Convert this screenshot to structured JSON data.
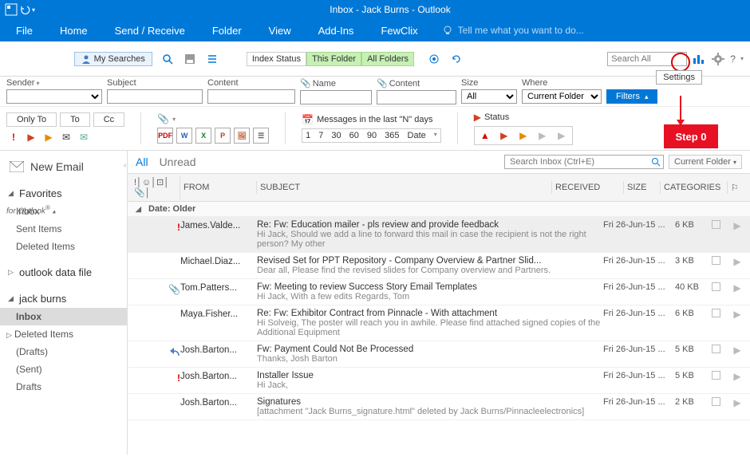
{
  "window": {
    "title": "Inbox - Jack Burns - Outlook"
  },
  "ribbon": {
    "tabs": [
      "File",
      "Home",
      "Send / Receive",
      "Folder",
      "View",
      "Add-Ins",
      "FewClix"
    ],
    "tell_me": "Tell me what you want to do..."
  },
  "fewclix": {
    "logo_main": "FewClix",
    "logo_sub": "for Outlook",
    "my_searches": "My Searches",
    "index_status": "Index Status",
    "this_folder": "This Folder",
    "all_folders": "All Folders",
    "search_placeholder": "Search All",
    "settings_tooltip": "Settings",
    "help_label": "?"
  },
  "annotations": {
    "step": "Step 0"
  },
  "filters": {
    "sender": "Sender",
    "subject": "Subject",
    "content": "Content",
    "name": "Name",
    "attach_content": "Content",
    "size": "Size",
    "size_value": "All",
    "where": "Where",
    "where_value": "Current Folder",
    "filters_btn": "Filters"
  },
  "secondary": {
    "only_to": "Only To",
    "to": "To",
    "cc": "Cc",
    "messages_label": "Messages in the last \"N\" days",
    "days": [
      "1",
      "7",
      "30",
      "60",
      "90",
      "365",
      "Date"
    ],
    "status_label": "Status"
  },
  "sidebar": {
    "new_email": "New Email",
    "favorites": {
      "label": "Favorites",
      "items": [
        "Inbox",
        "Sent Items",
        "Deleted Items"
      ]
    },
    "data_file": "outlook data file",
    "account": {
      "label": "jack burns",
      "items": [
        {
          "label": "Inbox",
          "selected": true
        },
        {
          "label": "Deleted Items",
          "selected": false
        },
        {
          "label": "(Drafts)",
          "selected": false
        },
        {
          "label": "(Sent)",
          "selected": false
        },
        {
          "label": "Drafts",
          "selected": false
        }
      ]
    }
  },
  "content_tabs": {
    "all": "All",
    "unread": "Unread"
  },
  "content_search": {
    "placeholder": "Search Inbox (Ctrl+E)",
    "scope": "Current Folder"
  },
  "columns": {
    "from": "FROM",
    "subject": "SUBJECT",
    "received": "RECEIVED",
    "size": "SIZE",
    "categories": "CATEGORIES"
  },
  "group": "Date: Older",
  "emails": [
    {
      "from": "James.Valde...",
      "subject": "Re: Fw: Education mailer - pls review and provide feedback",
      "preview": "Hi Jack,  Should we add a line to forward this mail in case the recipient is not the  right person? My other",
      "received": "Fri 26-Jun-15 ...",
      "size": "6 KB",
      "important": true,
      "attach": false,
      "reply": false,
      "sel": true
    },
    {
      "from": "Michael.Diaz...",
      "subject": "Revised Set for PPT Repository - Company Overview & Partner Slid...",
      "preview": "Dear all,  Please find the revised slides for Company overview and Partners.",
      "received": "Fri 26-Jun-15 ...",
      "size": "3 KB",
      "important": false,
      "attach": false,
      "reply": false,
      "sel": false
    },
    {
      "from": "Tom.Patters...",
      "subject": "Fw: Meeting to review Success Story Email Templates",
      "preview": "Hi Jack,  With a few edits  Regards,  Tom <end>",
      "received": "Fri 26-Jun-15 ...",
      "size": "40 KB",
      "important": false,
      "attach": true,
      "reply": false,
      "sel": false
    },
    {
      "from": "Maya.Fisher...",
      "subject": "Re: Fw: Exhibitor Contract from Pinnacle - With attachment",
      "preview": "Hi Solveig,  The poster will reach you in awhile. Please find attached signed copies of the  Additional Equipment",
      "received": "Fri 26-Jun-15 ...",
      "size": "6 KB",
      "important": false,
      "attach": false,
      "reply": false,
      "sel": false
    },
    {
      "from": "Josh.Barton...",
      "subject": "Fw: Payment Could Not Be Processed",
      "preview": "Thanks,  Josh Barton",
      "received": "Fri 26-Jun-15 ...",
      "size": "5 KB",
      "important": false,
      "attach": false,
      "reply": true,
      "sel": false
    },
    {
      "from": "Josh.Barton...",
      "subject": "Installer Issue",
      "preview": "Hi Jack,",
      "received": "Fri 26-Jun-15 ...",
      "size": "5 KB",
      "important": true,
      "attach": false,
      "reply": false,
      "sel": false
    },
    {
      "from": "Josh.Barton...",
      "subject": "Signatures",
      "preview": "[attachment \"Jack Burns_signature.html\" deleted by Jack  Burns/Pinnacleelectronics]",
      "received": "Fri 26-Jun-15 ...",
      "size": "2 KB",
      "important": false,
      "attach": false,
      "reply": false,
      "sel": false
    }
  ]
}
